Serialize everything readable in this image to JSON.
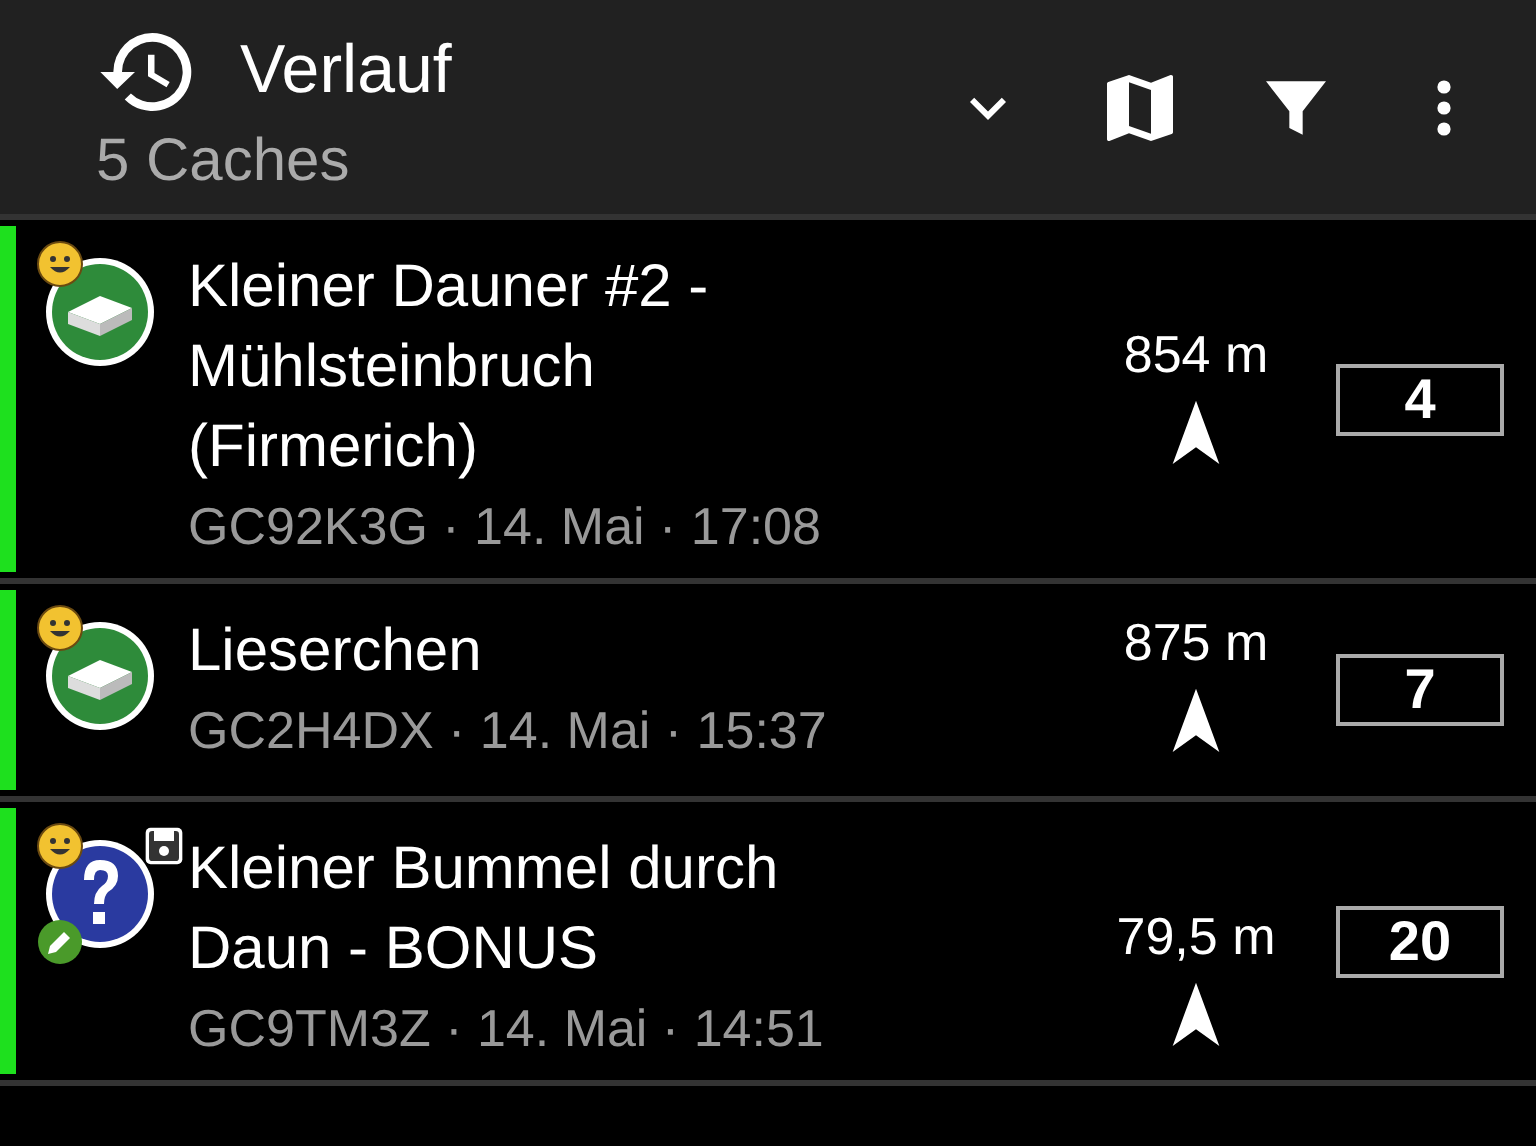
{
  "header": {
    "title": "Verlauf",
    "subtitle": "5 Caches"
  },
  "caches": [
    {
      "kind": "traditional",
      "name": "Kleiner Dauner #2 - Mühlsteinbruch (Firmerich)",
      "details": "GC92K3G · 14. Mai · 17:08",
      "distance": "854 m",
      "count": "4",
      "logged": true,
      "stored": false,
      "edited": false
    },
    {
      "kind": "traditional",
      "name": "Lieserchen",
      "details": "GC2H4DX · 14. Mai · 15:37",
      "distance": "875 m",
      "count": "7",
      "logged": true,
      "stored": false,
      "edited": false
    },
    {
      "kind": "mystery",
      "name": "Kleiner Bummel durch Daun - BONUS",
      "details": "GC9TM3Z · 14. Mai · 14:51",
      "distance": "79,5 m",
      "count": "20",
      "logged": true,
      "stored": true,
      "edited": true
    }
  ]
}
